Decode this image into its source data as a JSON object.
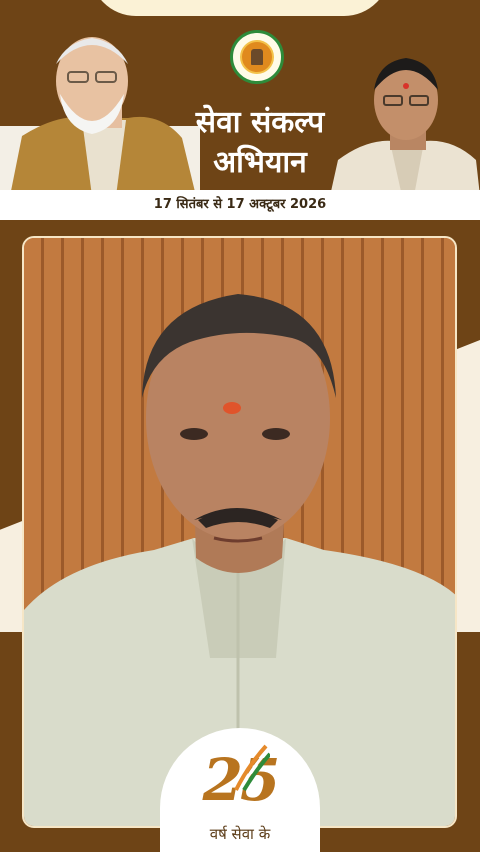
{
  "campaign": {
    "title_line1": "सेवा संकल्प",
    "title_line2": "अभियान",
    "date_range": "17 सितंबर से 17 अक्टूबर 2026"
  },
  "badge": {
    "number": "25",
    "text": "वर्ष सेवा के"
  },
  "colors": {
    "brown": "#6e4416",
    "cream": "#f7efe0",
    "gold": "#b8741f",
    "white": "#ffffff"
  },
  "icons": [
    "state-emblem-icon",
    "flag-ribbon-icon"
  ]
}
